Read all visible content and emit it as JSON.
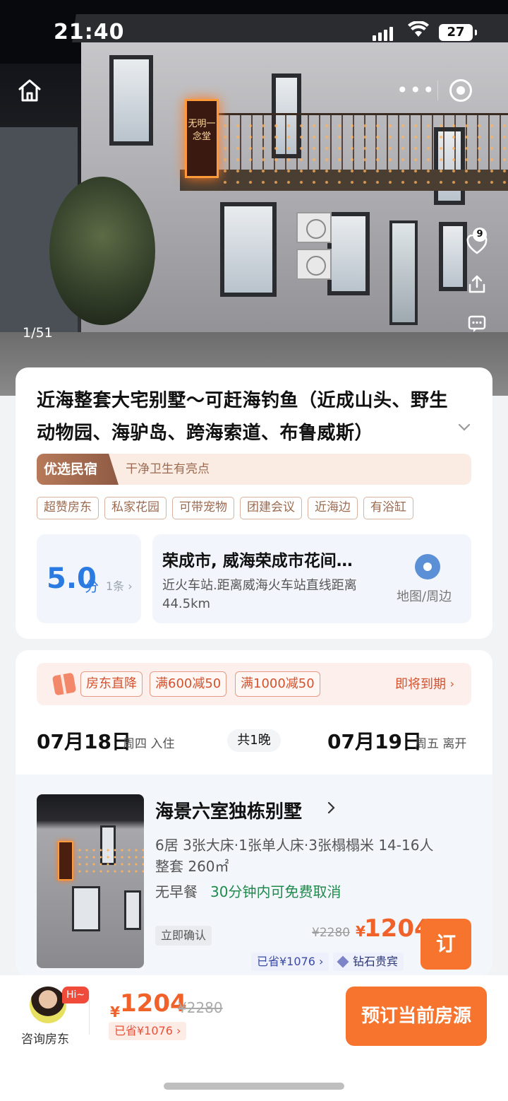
{
  "status": {
    "time": "21:40",
    "battery": "27"
  },
  "hero": {
    "photo_count": "1/51",
    "favorite_count": "9",
    "sign_text": "无明一念堂"
  },
  "listing": {
    "title": "近海整套大宅别墅～可赶海钓鱼（近成山头、野生动物园、海驴岛、跨海索道、布鲁威斯）",
    "badge": "优选民宿",
    "highlight": "干净卫生有亮点",
    "tags": [
      "超赞房东",
      "私家花园",
      "可带宠物",
      "团建会议",
      "近海边",
      "有浴缸"
    ],
    "score": "5.0",
    "score_unit": "分",
    "reviews": "1条 ›",
    "address": "荣成市, 威海荣成市花间…",
    "distance": "近火车站.距离威海火车站直线距离44.5km",
    "map_label": "地图/周边"
  },
  "promo": {
    "tags": [
      "房东直降",
      "满600减50",
      "满1000减50"
    ],
    "expire": "即将到期",
    "expire_arrow": "›"
  },
  "dates": {
    "checkin": "07月18日",
    "checkin_week": "周四 入住",
    "nights": "共1晚",
    "checkout": "07月19日",
    "checkout_week": "周五 离开"
  },
  "room": {
    "name": "海景六室独栋别墅",
    "spec": "6居 3张大床·1张单人床·3张榻榻米 14-16人",
    "spec2": "整套 260㎡",
    "meal": "无早餐",
    "cancel": "30分钟内可免费取消",
    "confirm": "立即确认",
    "old_price": "¥2280",
    "currency": "¥",
    "price": "1204",
    "saved": "已省¥1076 ›",
    "vip": "钻石贵宾",
    "book_label": "订"
  },
  "bottom": {
    "hi": "Hi~",
    "consult": "咨询房东",
    "currency": "¥",
    "price": "1204",
    "old_price": "¥2280",
    "saved": "已省¥1076 ›",
    "cta": "预订当前房源"
  },
  "colors": {
    "accent": "#f7742f",
    "price": "#f0622a",
    "score": "#2a7ae2",
    "cancel": "#1f8b4c"
  }
}
